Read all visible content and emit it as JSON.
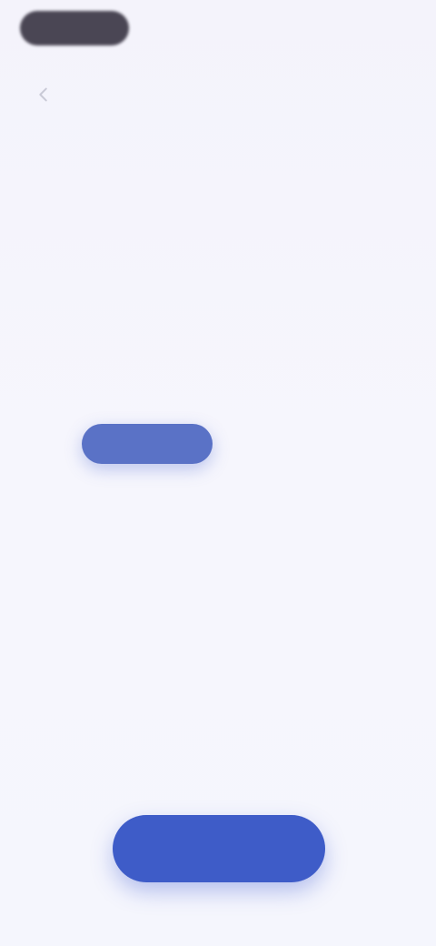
{
  "header": {
    "logo": "",
    "title": "",
    "action": ""
  },
  "subheader": {
    "step_label": ""
  },
  "question": {
    "title": "",
    "subtitle": ""
  },
  "options": [
    {
      "label": "",
      "selected": true
    },
    {
      "label": "",
      "selected": false
    },
    {
      "label": "",
      "selected": false
    },
    {
      "label": "",
      "selected": false
    },
    {
      "label": "",
      "selected": false
    }
  ],
  "continue_button": {
    "label": ""
  },
  "colors": {
    "accent": "#3e5cc8",
    "selected_option": "#5a72c6",
    "background": "#f5f5fc",
    "logo": "#4a4654"
  },
  "icons": {
    "back": "chevron-left-icon"
  }
}
